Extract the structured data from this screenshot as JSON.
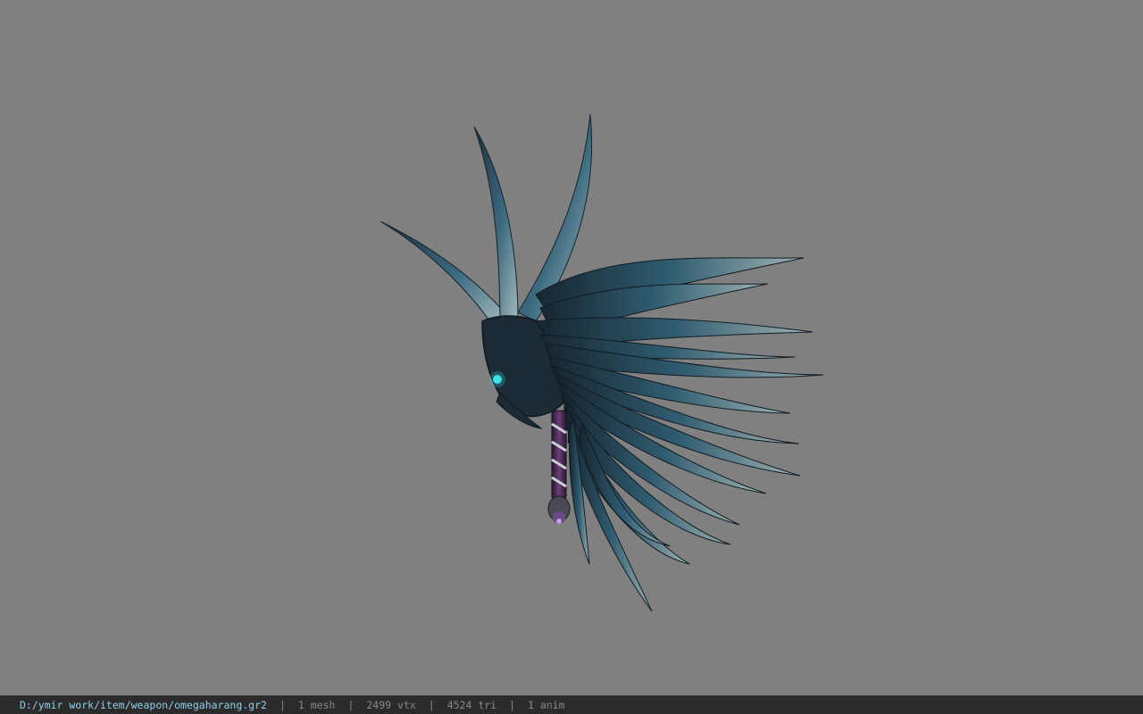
{
  "viewer": {
    "background_color": "#808080",
    "model_icon": "winged-blade-weapon-model"
  },
  "statusbar": {
    "file_path": "D:/ymir work/item/weapon/omegaharang.gr2",
    "separator": "|",
    "mesh": "1 mesh",
    "vertices": "2499 vtx",
    "triangles": "4524 tri",
    "animations": "1 anim",
    "path_color": "#8fd0ea",
    "stat_color": "#8a8a8a"
  }
}
